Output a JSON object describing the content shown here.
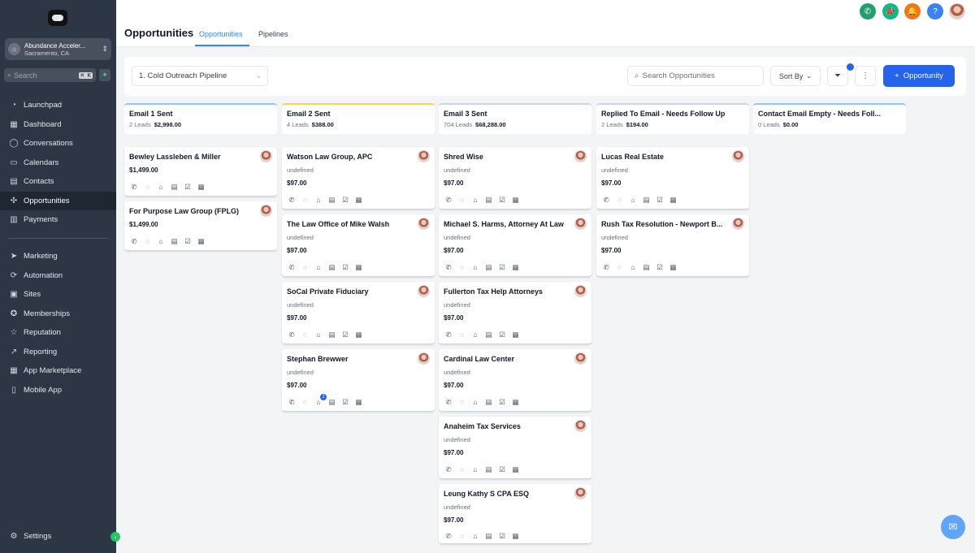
{
  "sidebar": {
    "account": {
      "name": "Abundance Acceler...",
      "location": "Sacramento, CA"
    },
    "search": {
      "placeholder": "Search",
      "shortcut": "⌘ K"
    },
    "items": [
      {
        "label": "Launchpad",
        "icon": "rocket-icon"
      },
      {
        "label": "Dashboard",
        "icon": "grid-icon"
      },
      {
        "label": "Conversations",
        "icon": "chat-icon"
      },
      {
        "label": "Calendars",
        "icon": "calendar-icon"
      },
      {
        "label": "Contacts",
        "icon": "contacts-icon"
      },
      {
        "label": "Opportunities",
        "icon": "network-icon",
        "active": true
      },
      {
        "label": "Payments",
        "icon": "payments-icon"
      },
      {
        "label": "Marketing",
        "icon": "send-icon"
      },
      {
        "label": "Automation",
        "icon": "automation-icon"
      },
      {
        "label": "Sites",
        "icon": "sites-icon"
      },
      {
        "label": "Memberships",
        "icon": "membership-icon"
      },
      {
        "label": "Reputation",
        "icon": "star-icon"
      },
      {
        "label": "Reporting",
        "icon": "trend-icon"
      },
      {
        "label": "App Marketplace",
        "icon": "apps-icon"
      },
      {
        "label": "Mobile App",
        "icon": "phone-icon"
      }
    ],
    "settings": "Settings"
  },
  "header": {
    "title": "Opportunities",
    "tabs": [
      "Opportunities",
      "Pipelines"
    ]
  },
  "toolbar": {
    "pipeline": "1. Cold Outreach Pipeline",
    "search_placeholder": "Search Opportunities",
    "sort_label": "Sort By",
    "add_label": "Opportunity"
  },
  "colors": {
    "accent": "#2563eb",
    "sidebar": "#2c3645"
  },
  "columns": [
    {
      "name": "Email 1 Sent",
      "leads": "2 Leads",
      "total": "$2,998.00"
    },
    {
      "name": "Email 2 Sent",
      "leads": "4 Leads",
      "total": "$388.00"
    },
    {
      "name": "Email 3 Sent",
      "leads": "704 Leads",
      "total": "$68,288.00"
    },
    {
      "name": "Replied To Email - Needs Follow Up",
      "leads": "2 Leads",
      "total": "$194.00"
    },
    {
      "name": "Contact Email Empty - Needs Foll...",
      "leads": "0 Leads",
      "total": "$0.00"
    }
  ],
  "cards": {
    "col0": [
      {
        "title": "Bewley Lassleben & Miller",
        "value": "$1,499.00"
      },
      {
        "title": "For Purpose Law Group (FPLG)",
        "value": "$1,499.00"
      }
    ],
    "col1": [
      {
        "title": "Watson Law Group, APC",
        "sub": "undefined",
        "value": "$97.00"
      },
      {
        "title": "The Law Office of Mike Walsh",
        "sub": "undefined",
        "value": "$97.00"
      },
      {
        "title": "SoCal Private Fiduciary",
        "sub": "undefined",
        "value": "$97.00"
      },
      {
        "title": "Stephan Brewwer",
        "sub": "undefined",
        "value": "$97.00",
        "badge": "1"
      }
    ],
    "col2": [
      {
        "title": "Shred Wise",
        "sub": "undefined",
        "value": "$97.00"
      },
      {
        "title": "Michael S. Harms, Attorney At Law",
        "sub": "undefined",
        "value": "$97.00"
      },
      {
        "title": "Fullerton Tax Help Attorneys",
        "sub": "undefined",
        "value": "$97.00"
      },
      {
        "title": "Cardinal Law Center",
        "sub": "undefined",
        "value": "$97.00"
      },
      {
        "title": "Anaheim Tax Services",
        "sub": "undefined",
        "value": "$97.00"
      },
      {
        "title": "Leung Kathy S CPA ESQ",
        "sub": "undefined",
        "value": "$97.00"
      }
    ],
    "col3": [
      {
        "title": "Lucas Real Estate",
        "sub": "undefined",
        "value": "$97.00"
      },
      {
        "title": "Rush Tax Resolution - Newport B...",
        "sub": "undefined",
        "value": "$97.00"
      }
    ]
  }
}
